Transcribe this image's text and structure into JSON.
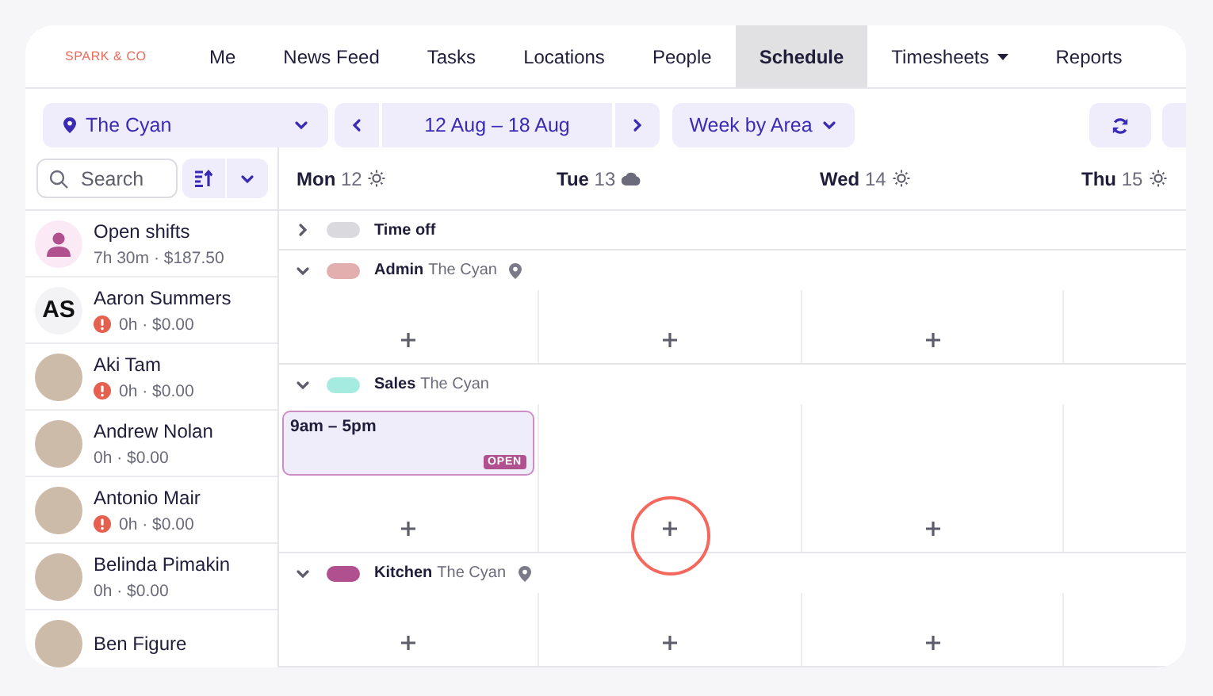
{
  "brand": "SPARK & CO",
  "nav": [
    {
      "label": "Me",
      "selected": false,
      "has_menu": false
    },
    {
      "label": "News Feed",
      "selected": false,
      "has_menu": false
    },
    {
      "label": "Tasks",
      "selected": false,
      "has_menu": false
    },
    {
      "label": "Locations",
      "selected": false,
      "has_menu": false
    },
    {
      "label": "People",
      "selected": false,
      "has_menu": false
    },
    {
      "label": "Schedule",
      "selected": true,
      "has_menu": false
    },
    {
      "label": "Timesheets",
      "selected": false,
      "has_menu": true
    },
    {
      "label": "Reports",
      "selected": false,
      "has_menu": false
    }
  ],
  "toolbar": {
    "location": "The Cyan",
    "date_range": "12 Aug – 18 Aug",
    "view": "Week by Area"
  },
  "search": {
    "placeholder": "Search"
  },
  "days": [
    {
      "name": "Mon",
      "date": "12",
      "kind": "sun"
    },
    {
      "name": "Tue",
      "date": "13",
      "kind": "cloud"
    },
    {
      "name": "Wed",
      "date": "14",
      "kind": "sun"
    },
    {
      "name": "Thu",
      "date": "15",
      "kind": "sun"
    }
  ],
  "people": [
    {
      "name": "Open shifts",
      "summary": "7h 30m · $187.50",
      "kind": "open",
      "warning": false
    },
    {
      "name": "Aaron Summers",
      "summary": "0h · $0.00",
      "kind": "initials",
      "initials": "AS",
      "warning": true
    },
    {
      "name": "Aki Tam",
      "summary": "0h · $0.00",
      "kind": "photo",
      "warning": true
    },
    {
      "name": "Andrew Nolan",
      "summary": "0h · $0.00",
      "kind": "photo",
      "warning": false
    },
    {
      "name": "Antonio Mair",
      "summary": "0h · $0.00",
      "kind": "photo",
      "warning": true
    },
    {
      "name": "Belinda Pimakin",
      "summary": "0h · $0.00",
      "kind": "photo",
      "warning": false
    },
    {
      "name": "Ben Figure",
      "kind": "photo"
    }
  ],
  "areas": [
    {
      "name": "Time off",
      "color": "#d9d9de",
      "expanded": false
    },
    {
      "name": "Admin",
      "location": "The Cyan",
      "color": "#e3aeae",
      "expanded": true,
      "pin": true,
      "cells": [
        {
          "highlighted": false
        },
        {
          "highlighted": false
        },
        {
          "highlighted": false
        }
      ]
    },
    {
      "name": "Sales",
      "location": "The Cyan",
      "color": "#a6ebe0",
      "expanded": true,
      "pin": false,
      "cells": [
        {
          "highlighted": false,
          "shifts": [
            {
              "time": "9am – 5pm",
              "badge": "OPEN"
            }
          ]
        },
        {
          "highlighted": true
        },
        {
          "highlighted": false
        }
      ]
    },
    {
      "name": "Kitchen",
      "location": "The Cyan",
      "color": "#b0508f",
      "expanded": true,
      "pin": true,
      "cells": [
        {
          "highlighted": false
        },
        {
          "highlighted": false
        },
        {
          "highlighted": false
        }
      ]
    }
  ]
}
